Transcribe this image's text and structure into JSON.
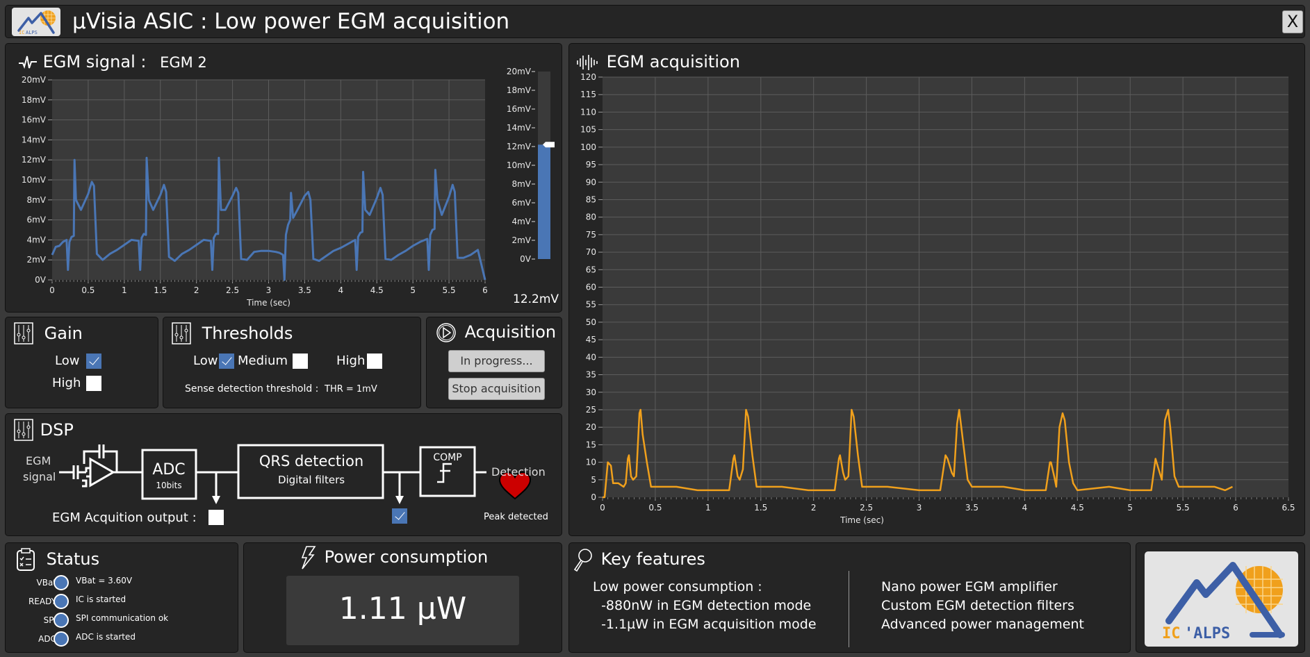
{
  "window": {
    "title": "µVisia ASIC : Low power EGM acquisition",
    "close_label": "X",
    "logo_text": "IC'ALPS"
  },
  "egm_signal": {
    "title": "EGM signal :",
    "channel": "EGM 2",
    "slider": {
      "value_label": "12.2mV",
      "value_mV": 12.2,
      "ticks": [
        "20mV",
        "18mV",
        "16mV",
        "14mV",
        "12mV",
        "10mV",
        "8mV",
        "6mV",
        "4mV",
        "2mV",
        "0V"
      ]
    }
  },
  "gain": {
    "title": "Gain",
    "options": [
      {
        "label": "Low",
        "checked": true
      },
      {
        "label": "High",
        "checked": false
      }
    ]
  },
  "thresholds": {
    "title": "Thresholds",
    "options": [
      {
        "label": "Low",
        "checked": true
      },
      {
        "label": "Medium",
        "checked": false
      },
      {
        "label": "High",
        "checked": false
      }
    ],
    "sense_label": "Sense detection threshold :",
    "sense_value": "THR = 1mV"
  },
  "acquisition": {
    "title": "Acquisition",
    "status_button": "In progress...",
    "stop_button": "Stop acquisition"
  },
  "dsp": {
    "title": "DSP",
    "input_label_1": "EGM",
    "input_label_2": "signal",
    "adc_label": "ADC",
    "adc_sub": "10bits",
    "qrs_label": "QRS detection",
    "qrs_sub": "Digital filters",
    "comp_label": "COMP",
    "detection_label": "Detection",
    "output_label": "EGM Acquition output :",
    "output_checked": false,
    "qrs_output_checked": true,
    "peak_label": "Peak detected",
    "heart_color": "#cc0000"
  },
  "status": {
    "title": "Status",
    "items": [
      {
        "name": "VBat",
        "text": "VBat = 3.60V"
      },
      {
        "name": "READY",
        "text": "IC is started"
      },
      {
        "name": "SPI",
        "text": "SPI communication ok"
      },
      {
        "name": "ADC",
        "text": "ADC is started"
      }
    ]
  },
  "power": {
    "title": "Power consumption",
    "value": "1.11 µW"
  },
  "key_features": {
    "title": "Key features",
    "left": [
      "Low power consumption :",
      "  -880nW in EGM detection mode",
      "  -1.1µW in EGM acquisition mode"
    ],
    "right": [
      "Nano power EGM amplifier",
      "Custom EGM detection filters",
      "Advanced power management"
    ]
  },
  "colors": {
    "signal": "#4a76b5",
    "acquisition": "#f0a01c",
    "panel": "#252525",
    "plot_bg": "#3a3a3a"
  },
  "chart_data": [
    {
      "type": "line",
      "title": "EGM signal",
      "xlabel": "Time (sec)",
      "ylabel": "",
      "xlim": [
        0,
        6
      ],
      "ylim": [
        0,
        20
      ],
      "x_ticks": [
        "0",
        "0.5",
        "1",
        "1.5",
        "2",
        "2.5",
        "3",
        "3.5",
        "4",
        "4.5",
        "5",
        "5.5",
        "6"
      ],
      "y_ticks": [
        "0V",
        "2mV",
        "4mV",
        "6mV",
        "8mV",
        "10mV",
        "12mV",
        "14mV",
        "16mV",
        "18mV",
        "20mV"
      ],
      "grid": true,
      "series": [
        {
          "name": "EGM 2 (mV)",
          "color": "#4a76b5",
          "x": [
            0,
            0.05,
            0.1,
            0.15,
            0.2,
            0.22,
            0.24,
            0.27,
            0.3,
            0.31,
            0.33,
            0.4,
            0.5,
            0.55,
            0.58,
            0.62,
            0.7,
            0.8,
            0.9,
            1.0,
            1.1,
            1.2,
            1.22,
            1.24,
            1.27,
            1.3,
            1.31,
            1.34,
            1.4,
            1.5,
            1.55,
            1.58,
            1.62,
            1.7,
            1.8,
            1.9,
            2.0,
            2.1,
            2.2,
            2.22,
            2.24,
            2.27,
            2.3,
            2.31,
            2.34,
            2.4,
            2.5,
            2.55,
            2.58,
            2.62,
            2.7,
            2.8,
            2.9,
            3.0,
            3.1,
            3.15,
            3.2,
            3.22,
            3.24,
            3.27,
            3.3,
            3.31,
            3.34,
            3.4,
            3.5,
            3.55,
            3.58,
            3.62,
            3.7,
            3.8,
            3.9,
            4.0,
            4.1,
            4.2,
            4.22,
            4.24,
            4.27,
            4.3,
            4.31,
            4.34,
            4.4,
            4.5,
            4.55,
            4.58,
            4.62,
            4.7,
            4.8,
            4.9,
            5.0,
            5.1,
            5.2,
            5.22,
            5.24,
            5.27,
            5.3,
            5.31,
            5.34,
            5.4,
            5.5,
            5.55,
            5.58,
            5.62,
            5.7,
            5.8,
            5.9,
            6.0
          ],
          "y": [
            2.5,
            3.3,
            3.4,
            3.8,
            4.0,
            1.0,
            3.8,
            4.3,
            4.4,
            12.0,
            8.0,
            7.0,
            8.6,
            9.8,
            9.4,
            2.6,
            2.0,
            2.6,
            3.0,
            3.5,
            4.0,
            3.9,
            1.0,
            4.2,
            4.6,
            4.5,
            12.2,
            8.0,
            7.0,
            8.5,
            9.5,
            8.8,
            2.3,
            1.9,
            2.6,
            3.0,
            3.5,
            4.0,
            3.9,
            1.0,
            4.2,
            4.6,
            4.6,
            12.2,
            7.0,
            7.0,
            8.4,
            9.2,
            8.7,
            2.1,
            2.0,
            2.8,
            2.9,
            2.9,
            2.8,
            2.7,
            2.5,
            0.0,
            4.5,
            5.5,
            6.0,
            8.7,
            6.2,
            7.0,
            8.4,
            8.8,
            8.0,
            2.1,
            1.9,
            2.4,
            2.9,
            3.2,
            3.6,
            4.0,
            1.0,
            4.3,
            4.7,
            4.8,
            10.8,
            7.0,
            6.5,
            8.2,
            9.2,
            8.5,
            2.1,
            2.0,
            2.5,
            2.9,
            3.4,
            3.8,
            4.1,
            1.0,
            4.5,
            5.0,
            5.1,
            11.0,
            8.0,
            6.5,
            8.3,
            9.5,
            8.8,
            2.2,
            2.2,
            2.5,
            3.0,
            0.0
          ]
        }
      ]
    },
    {
      "type": "line",
      "title": "EGM acquisition",
      "xlabel": "Time (sec)",
      "ylabel": "",
      "xlim": [
        0,
        6.5
      ],
      "ylim": [
        0,
        120
      ],
      "x_ticks": [
        "0",
        "0.5",
        "1",
        "1.5",
        "2",
        "2.5",
        "3",
        "3.5",
        "4",
        "4.5",
        "5",
        "5.5",
        "6",
        "6.5"
      ],
      "y_ticks": [
        "0",
        "5",
        "10",
        "15",
        "20",
        "25",
        "30",
        "35",
        "40",
        "45",
        "50",
        "55",
        "60",
        "65",
        "70",
        "75",
        "80",
        "85",
        "90",
        "95",
        "100",
        "105",
        "110",
        "115",
        "120"
      ],
      "grid": true,
      "series": [
        {
          "name": "EGM acquisition",
          "color": "#f0a01c",
          "x": [
            0,
            0.02,
            0.05,
            0.08,
            0.1,
            0.15,
            0.2,
            0.22,
            0.24,
            0.25,
            0.27,
            0.29,
            0.32,
            0.35,
            0.36,
            0.38,
            0.42,
            0.46,
            0.5,
            0.7,
            0.9,
            1.0,
            1.2,
            1.24,
            1.25,
            1.28,
            1.3,
            1.33,
            1.36,
            1.38,
            1.42,
            1.46,
            1.5,
            1.7,
            1.95,
            2.0,
            2.2,
            2.24,
            2.25,
            2.28,
            2.3,
            2.33,
            2.36,
            2.38,
            2.42,
            2.46,
            2.5,
            2.7,
            3.0,
            3.2,
            3.25,
            3.27,
            3.3,
            3.31,
            3.33,
            3.36,
            3.38,
            3.42,
            3.46,
            3.5,
            3.8,
            4.0,
            4.2,
            4.24,
            4.25,
            4.28,
            4.3,
            4.33,
            4.36,
            4.38,
            4.42,
            4.46,
            4.5,
            4.8,
            5.0,
            5.2,
            5.24,
            5.25,
            5.28,
            5.3,
            5.33,
            5.36,
            5.38,
            5.42,
            5.46,
            5.5,
            5.8,
            5.9,
            5.97
          ],
          "y": [
            0,
            0,
            10,
            9,
            4,
            4,
            3,
            4,
            11,
            12,
            6,
            5,
            6,
            24,
            25,
            18,
            10,
            3,
            3,
            3,
            2,
            2,
            2,
            11,
            12,
            6,
            5,
            8,
            25,
            23,
            12,
            3,
            3,
            3,
            2,
            2,
            2,
            11,
            12,
            7,
            5,
            6,
            25,
            23,
            12,
            3,
            3,
            3,
            2,
            2,
            12,
            11,
            8,
            7,
            6,
            21,
            25,
            15,
            5,
            3,
            3,
            2,
            2,
            10,
            10,
            6,
            3,
            20,
            24,
            22,
            10,
            4,
            2,
            3,
            2,
            2,
            11,
            10,
            7,
            5,
            22,
            25,
            20,
            6,
            3,
            3,
            3,
            2,
            3
          ]
        }
      ]
    }
  ]
}
